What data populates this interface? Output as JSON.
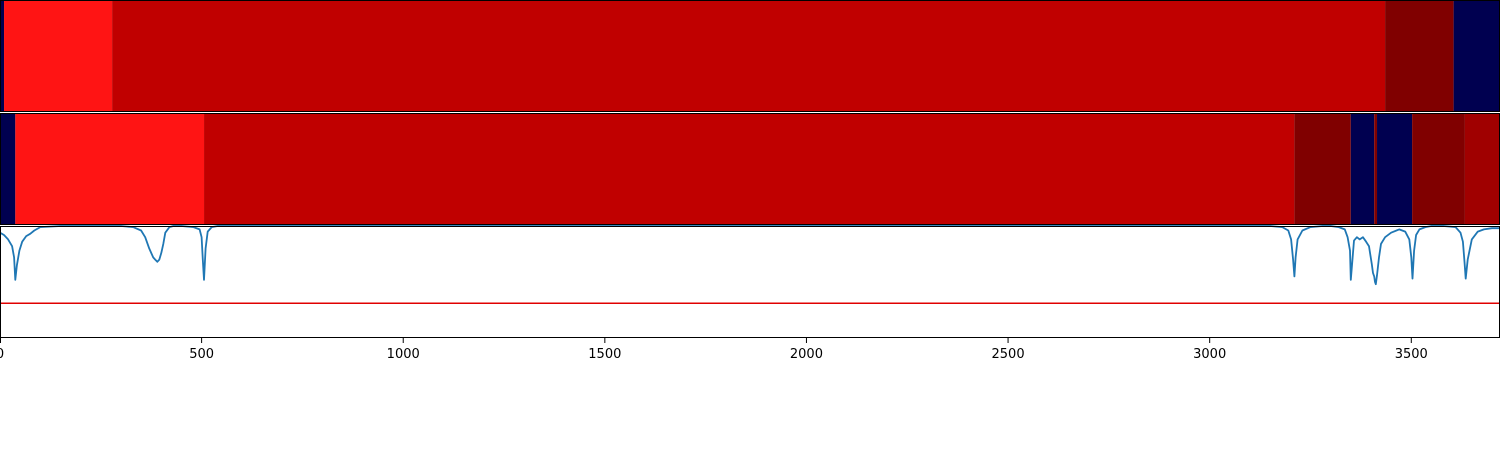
{
  "chart_data": [
    {
      "type": "bar",
      "subtype": "broken_barh",
      "xlim": [
        0,
        3720
      ],
      "segments": [
        {
          "start": 0,
          "end": 10,
          "color": "#000050"
        },
        {
          "start": 10,
          "end": 278,
          "color": "#ff1414"
        },
        {
          "start": 278,
          "end": 3435,
          "color": "#c00000"
        },
        {
          "start": 3435,
          "end": 3605,
          "color": "#800000"
        },
        {
          "start": 3605,
          "end": 3720,
          "color": "#000050"
        }
      ]
    },
    {
      "type": "bar",
      "subtype": "broken_barh",
      "xlim": [
        0,
        3720
      ],
      "segments": [
        {
          "start": 0,
          "end": 38,
          "color": "#000050"
        },
        {
          "start": 38,
          "end": 506,
          "color": "#ff1414"
        },
        {
          "start": 506,
          "end": 3210,
          "color": "#c00000"
        },
        {
          "start": 3210,
          "end": 3350,
          "color": "#800000"
        },
        {
          "start": 3350,
          "end": 3408,
          "color": "#000050"
        },
        {
          "start": 3408,
          "end": 3415,
          "color": "#800000"
        },
        {
          "start": 3415,
          "end": 3502,
          "color": "#000050"
        },
        {
          "start": 3502,
          "end": 3633,
          "color": "#800000"
        },
        {
          "start": 3633,
          "end": 3720,
          "color": "#a00000"
        }
      ]
    },
    {
      "type": "line",
      "xlim": [
        0,
        3720
      ],
      "ylim": [
        0,
        1
      ],
      "grid": false,
      "x_ticks": [
        0,
        500,
        1000,
        1500,
        2000,
        2500,
        3000,
        3500
      ],
      "x_tick_labels": [
        "0",
        "500",
        "1000",
        "1500",
        "2000",
        "2500",
        "3000",
        "3500"
      ],
      "threshold": {
        "value": 0.31,
        "color": "#e00000"
      },
      "series": [
        {
          "color": "#1f77b4",
          "x": [
            0,
            10,
            20,
            30,
            35,
            38,
            42,
            48,
            55,
            65,
            75,
            85,
            100,
            150,
            250,
            280,
            300,
            330,
            350,
            360,
            370,
            380,
            385,
            390,
            395,
            400,
            405,
            410,
            420,
            430,
            450,
            480,
            495,
            500,
            503,
            506,
            510,
            515,
            525,
            540,
            560,
            1000,
            2000,
            3000,
            3150,
            3180,
            3195,
            3202,
            3207,
            3210,
            3213,
            3218,
            3230,
            3250,
            3280,
            3300,
            3320,
            3335,
            3342,
            3348,
            3350,
            3353,
            3358,
            3365,
            3372,
            3380,
            3388,
            3395,
            3398,
            3402,
            3405,
            3408,
            3410,
            3412,
            3415,
            3420,
            3425,
            3435,
            3450,
            3470,
            3485,
            3495,
            3500,
            3503,
            3507,
            3512,
            3520,
            3535,
            3550,
            3580,
            3610,
            3622,
            3628,
            3632,
            3635,
            3640,
            3650,
            3665,
            3680,
            3700,
            3720
          ],
          "y": [
            0.94,
            0.92,
            0.88,
            0.82,
            0.72,
            0.52,
            0.65,
            0.78,
            0.86,
            0.91,
            0.93,
            0.96,
            0.99,
            1.0,
            1.0,
            1.0,
            1.0,
            0.99,
            0.96,
            0.9,
            0.8,
            0.72,
            0.7,
            0.68,
            0.7,
            0.76,
            0.84,
            0.94,
            0.99,
            1.0,
            1.0,
            0.99,
            0.97,
            0.9,
            0.7,
            0.52,
            0.8,
            0.95,
            0.99,
            1.0,
            1.0,
            1.0,
            1.0,
            1.0,
            1.0,
            0.99,
            0.96,
            0.88,
            0.7,
            0.55,
            0.72,
            0.88,
            0.96,
            0.99,
            1.0,
            1.0,
            0.99,
            0.97,
            0.9,
            0.78,
            0.52,
            0.65,
            0.87,
            0.9,
            0.88,
            0.9,
            0.86,
            0.82,
            0.75,
            0.66,
            0.58,
            0.55,
            0.5,
            0.48,
            0.56,
            0.72,
            0.84,
            0.9,
            0.94,
            0.97,
            0.95,
            0.88,
            0.72,
            0.53,
            0.78,
            0.92,
            0.97,
            0.99,
            1.0,
            1.0,
            0.99,
            0.94,
            0.86,
            0.68,
            0.53,
            0.7,
            0.88,
            0.95,
            0.97,
            0.98,
            0.98
          ]
        }
      ]
    }
  ]
}
